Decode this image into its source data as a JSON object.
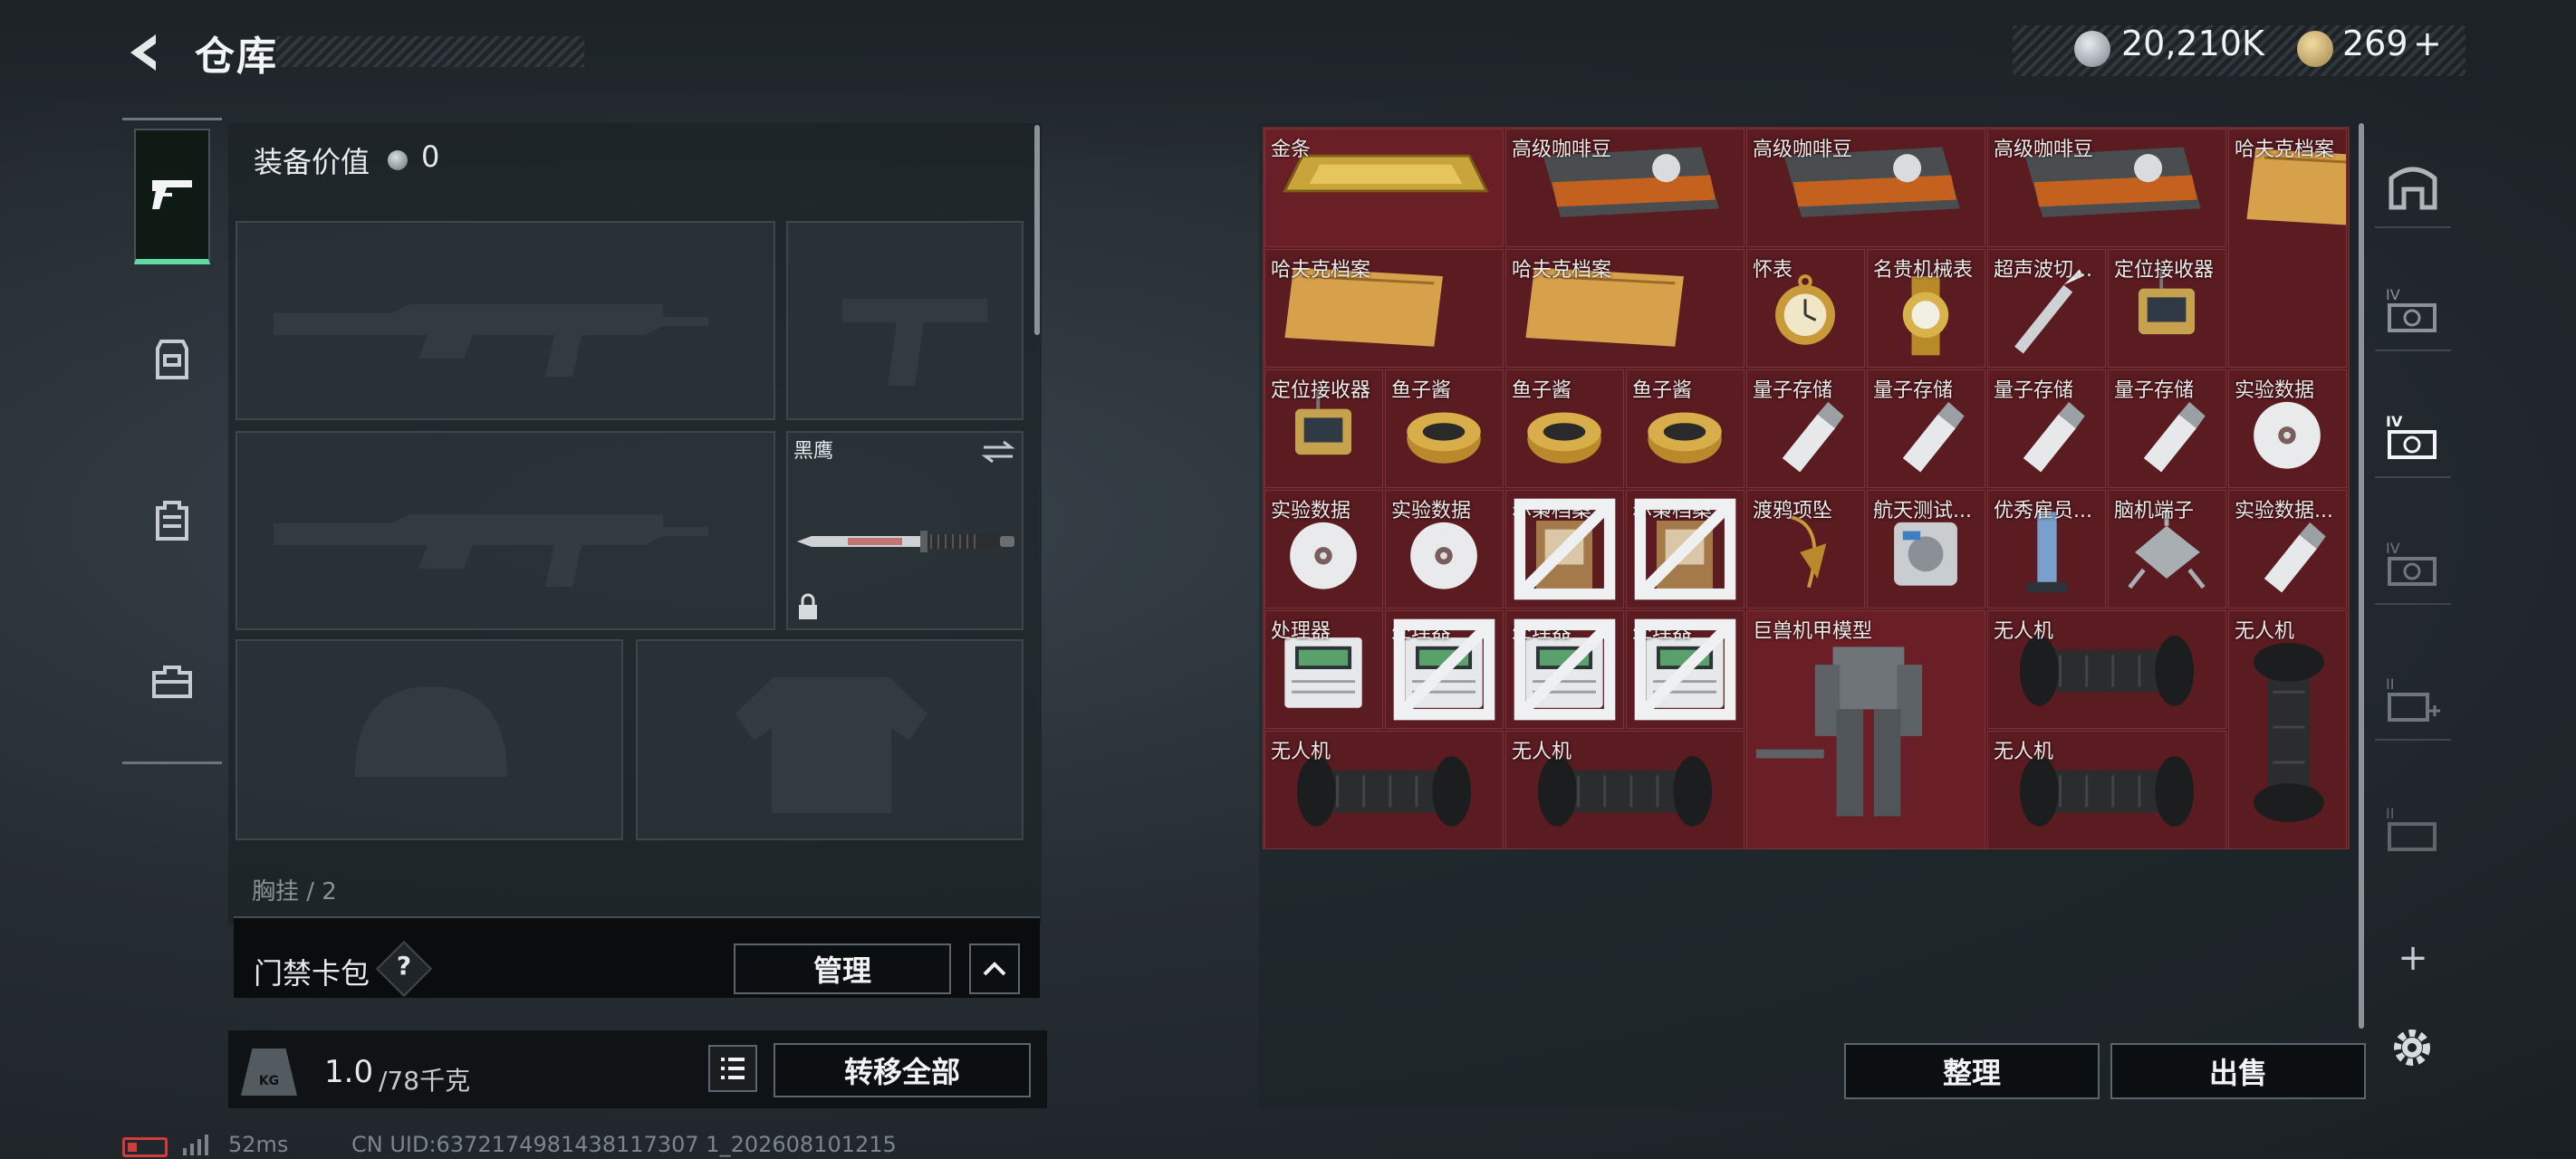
{
  "header": {
    "title": "仓库",
    "currency1": "20,210K",
    "currency2": "269",
    "currency2_plus": "+"
  },
  "equipment": {
    "value_label": "装备价值",
    "value": "0",
    "knife_label": "黑鹰",
    "chest_label": "胸挂 / 2"
  },
  "access_card": {
    "label": "门禁卡包",
    "help": "?",
    "manage_label": "管理"
  },
  "weight": {
    "current": "1.0",
    "capacity": "/78千克",
    "transfer_all_label": "转移全部"
  },
  "storage": {
    "items": [
      {
        "name": "金条",
        "icon": "gold-bar",
        "r": 0,
        "c": 0,
        "w": 2,
        "h": 1,
        "no_trade": false
      },
      {
        "name": "高级咖啡豆",
        "icon": "coffee-bag",
        "r": 0,
        "c": 2,
        "w": 2,
        "h": 1,
        "no_trade": false
      },
      {
        "name": "高级咖啡豆",
        "icon": "coffee-bag",
        "r": 0,
        "c": 4,
        "w": 2,
        "h": 1,
        "no_trade": false
      },
      {
        "name": "高级咖啡豆",
        "icon": "coffee-bag",
        "r": 0,
        "c": 6,
        "w": 2,
        "h": 1,
        "no_trade": false
      },
      {
        "name": "哈夫克档案",
        "icon": "dossier",
        "r": 0,
        "c": 8,
        "w": 1,
        "h": 2,
        "no_trade": false
      },
      {
        "name": "哈夫克档案",
        "icon": "dossier",
        "r": 1,
        "c": 0,
        "w": 2,
        "h": 1,
        "no_trade": false
      },
      {
        "name": "哈夫克档案",
        "icon": "dossier",
        "r": 1,
        "c": 2,
        "w": 2,
        "h": 1,
        "no_trade": false
      },
      {
        "name": "怀表",
        "icon": "pocket-watch",
        "r": 1,
        "c": 4,
        "w": 1,
        "h": 1,
        "no_trade": false
      },
      {
        "name": "名贵机械表",
        "icon": "wristwatch",
        "r": 1,
        "c": 5,
        "w": 1,
        "h": 1,
        "no_trade": false
      },
      {
        "name": "超声波切...",
        "icon": "scalpel",
        "r": 1,
        "c": 6,
        "w": 1,
        "h": 1,
        "no_trade": false
      },
      {
        "name": "定位接收器",
        "icon": "receiver",
        "r": 1,
        "c": 7,
        "w": 1,
        "h": 1,
        "no_trade": false
      },
      {
        "name": "定位接收器",
        "icon": "receiver",
        "r": 2,
        "c": 0,
        "w": 1,
        "h": 1,
        "no_trade": false
      },
      {
        "name": "鱼子酱",
        "icon": "caviar",
        "r": 2,
        "c": 1,
        "w": 1,
        "h": 1,
        "no_trade": false
      },
      {
        "name": "鱼子酱",
        "icon": "caviar",
        "r": 2,
        "c": 2,
        "w": 1,
        "h": 1,
        "no_trade": false
      },
      {
        "name": "鱼子酱",
        "icon": "caviar",
        "r": 2,
        "c": 3,
        "w": 1,
        "h": 1,
        "no_trade": false
      },
      {
        "name": "量子存储",
        "icon": "usb-drive",
        "r": 2,
        "c": 4,
        "w": 1,
        "h": 1,
        "no_trade": false
      },
      {
        "name": "量子存储",
        "icon": "usb-drive",
        "r": 2,
        "c": 5,
        "w": 1,
        "h": 1,
        "no_trade": false
      },
      {
        "name": "量子存储",
        "icon": "usb-drive",
        "r": 2,
        "c": 6,
        "w": 1,
        "h": 1,
        "no_trade": false
      },
      {
        "name": "量子存储",
        "icon": "usb-drive",
        "r": 2,
        "c": 7,
        "w": 1,
        "h": 1,
        "no_trade": false
      },
      {
        "name": "实验数据",
        "icon": "disc",
        "r": 2,
        "c": 8,
        "w": 1,
        "h": 1,
        "no_trade": false
      },
      {
        "name": "实验数据",
        "icon": "disc",
        "r": 3,
        "c": 0,
        "w": 1,
        "h": 1,
        "no_trade": false
      },
      {
        "name": "实验数据",
        "icon": "disc",
        "r": 3,
        "c": 1,
        "w": 1,
        "h": 1,
        "no_trade": false
      },
      {
        "name": "赤枭档案",
        "icon": "photo-file",
        "r": 3,
        "c": 2,
        "w": 1,
        "h": 1,
        "no_trade": true
      },
      {
        "name": "赤枭档案",
        "icon": "photo-file",
        "r": 3,
        "c": 3,
        "w": 1,
        "h": 1,
        "no_trade": true
      },
      {
        "name": "渡鸦项坠",
        "icon": "pendant",
        "r": 3,
        "c": 4,
        "w": 1,
        "h": 1,
        "no_trade": false
      },
      {
        "name": "航天测试...",
        "icon": "test-device",
        "r": 3,
        "c": 5,
        "w": 1,
        "h": 1,
        "no_trade": false
      },
      {
        "name": "优秀雇员...",
        "icon": "trophy",
        "r": 3,
        "c": 6,
        "w": 1,
        "h": 1,
        "no_trade": false
      },
      {
        "name": "脑机端子",
        "icon": "neural-port",
        "r": 3,
        "c": 7,
        "w": 1,
        "h": 1,
        "no_trade": false
      },
      {
        "name": "实验数据...",
        "icon": "usb-drive",
        "r": 3,
        "c": 8,
        "w": 1,
        "h": 1,
        "no_trade": false
      },
      {
        "name": "处理器",
        "icon": "processor",
        "r": 4,
        "c": 0,
        "w": 1,
        "h": 1,
        "no_trade": false
      },
      {
        "name": "处理器",
        "icon": "processor",
        "r": 4,
        "c": 1,
        "w": 1,
        "h": 1,
        "no_trade": true
      },
      {
        "name": "处理器",
        "icon": "processor",
        "r": 4,
        "c": 2,
        "w": 1,
        "h": 1,
        "no_trade": true
      },
      {
        "name": "处理器",
        "icon": "processor",
        "r": 4,
        "c": 3,
        "w": 1,
        "h": 1,
        "no_trade": true
      },
      {
        "name": "巨兽机甲模型",
        "icon": "mech-model",
        "r": 4,
        "c": 4,
        "w": 2,
        "h": 2,
        "no_trade": false
      },
      {
        "name": "无人机",
        "icon": "drone-roller",
        "r": 4,
        "c": 6,
        "w": 2,
        "h": 1,
        "no_trade": false
      },
      {
        "name": "无人机",
        "icon": "drone-roller-vertical",
        "r": 4,
        "c": 8,
        "w": 1,
        "h": 2,
        "no_trade": false
      },
      {
        "name": "无人机",
        "icon": "drone-roller",
        "r": 5,
        "c": 0,
        "w": 2,
        "h": 1,
        "no_trade": false
      },
      {
        "name": "无人机",
        "icon": "drone-roller",
        "r": 5,
        "c": 2,
        "w": 2,
        "h": 1,
        "no_trade": false
      },
      {
        "name": "无人机",
        "icon": "drone-roller",
        "r": 5,
        "c": 6,
        "w": 2,
        "h": 1,
        "no_trade": false
      }
    ],
    "sort_label": "整理",
    "sell_label": "出售"
  },
  "status": {
    "ping": "52ms",
    "uid": "CN UID:6372174981438117307 1_202608101215"
  },
  "colors": {
    "accent": "#63d9a6",
    "cell_bg": "#5e1c22",
    "cell_border": "#7a3a40"
  }
}
